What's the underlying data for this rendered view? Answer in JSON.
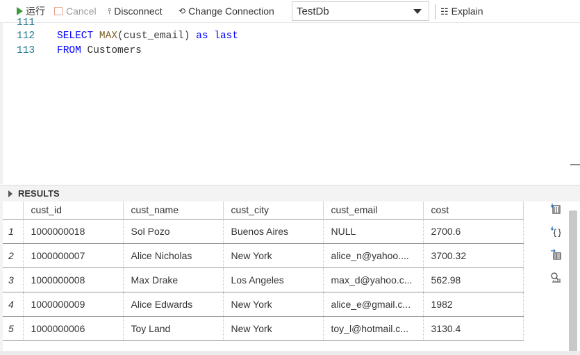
{
  "toolbar": {
    "run_label": "运行",
    "cancel_label": "Cancel",
    "disconnect_label": "Disconnect",
    "change_connection_label": "Change Connection",
    "connection_selected": "TestDb",
    "explain_label": "Explain"
  },
  "editor": {
    "lines": [
      {
        "number": "111",
        "tokens": []
      },
      {
        "number": "112",
        "tokens": [
          {
            "text": "SELECT",
            "cls": "kw"
          },
          {
            "text": " ",
            "cls": "ident"
          },
          {
            "text": "MAX",
            "cls": "fn"
          },
          {
            "text": "(cust_email) ",
            "cls": "ident"
          },
          {
            "text": "as",
            "cls": "kw"
          },
          {
            "text": " ",
            "cls": "ident"
          },
          {
            "text": "last",
            "cls": "kw"
          }
        ]
      },
      {
        "number": "113",
        "tokens": [
          {
            "text": "FROM",
            "cls": "kw"
          },
          {
            "text": " Customers",
            "cls": "ident"
          }
        ]
      }
    ]
  },
  "results": {
    "title": "RESULTS",
    "columns": [
      "cust_id",
      "cust_name",
      "cust_city",
      "cust_email",
      "cost"
    ],
    "rows": [
      [
        "1",
        "1000000018",
        "Sol Pozo",
        "Buenos Aires",
        "NULL",
        "2700.6"
      ],
      [
        "2",
        "1000000007",
        "Alice Nicholas",
        "New York",
        "alice_n@yahoo....",
        "3700.32"
      ],
      [
        "3",
        "1000000008",
        "Max Drake",
        "Los Angeles",
        "max_d@yahoo.c...",
        "562.98"
      ],
      [
        "4",
        "1000000009",
        "Alice Edwards",
        "New York",
        "alice_e@gmail.c...",
        "1982"
      ],
      [
        "5",
        "1000000006",
        "Toy Land",
        "New York",
        "toy_l@hotmail.c...",
        "3130.4"
      ]
    ],
    "side_icons": [
      "save-csv-icon",
      "save-json-icon",
      "save-excel-icon",
      "chart-icon"
    ]
  },
  "colors": {
    "keyword": "#0000ff",
    "function": "#795e26",
    "line_number": "#237893",
    "run_green": "#3b9a3b"
  }
}
